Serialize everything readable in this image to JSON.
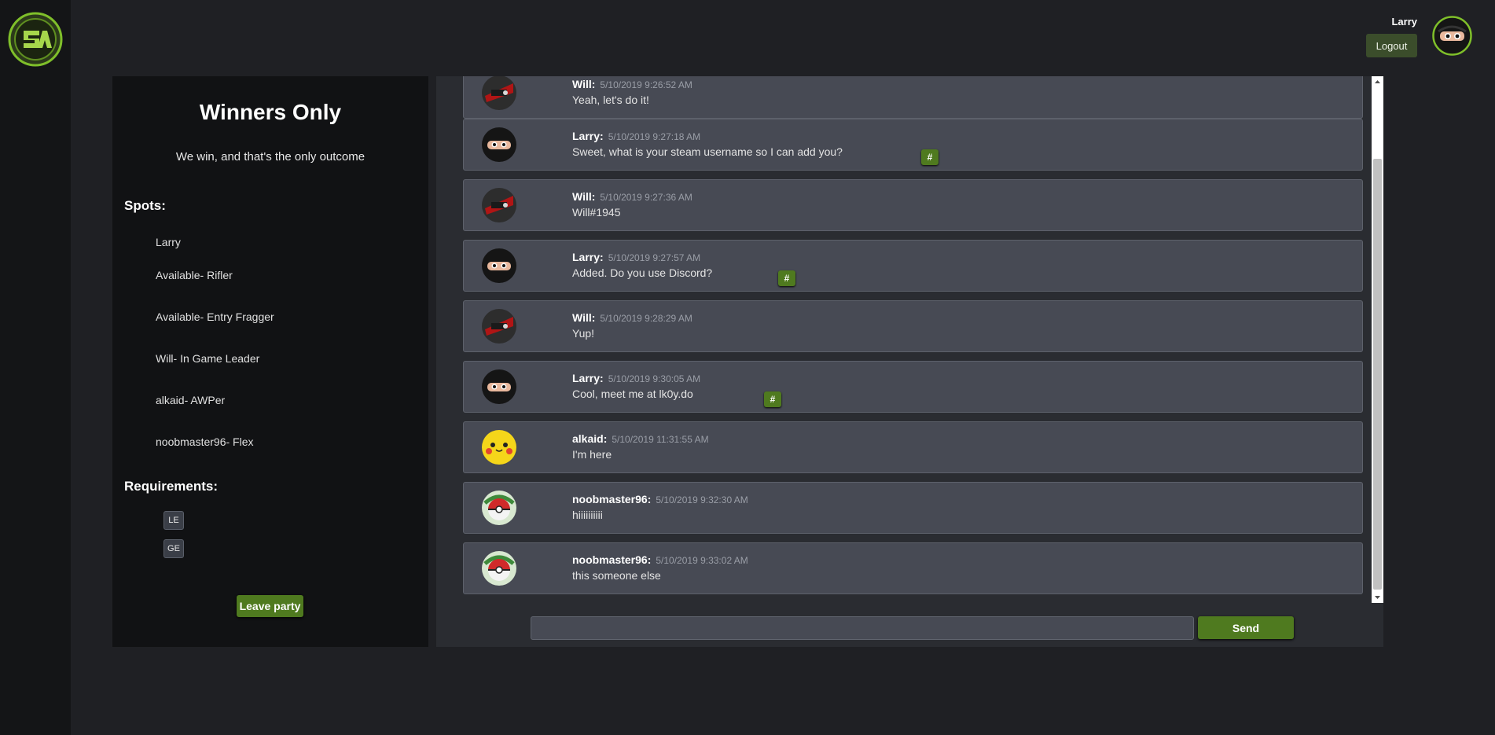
{
  "header": {
    "user_name": "Larry",
    "logout_label": "Logout",
    "avatar_icon": "ninja-avatar-icon"
  },
  "logo": {
    "icon": "sa-logo-icon",
    "accent_color": "#7fbf2a"
  },
  "party": {
    "title": "Winners Only",
    "description": "We win, and that's the only outcome",
    "spots_heading": "Spots:",
    "spots": [
      "Larry",
      "Available- Rifler",
      "Available- Entry Fragger",
      "Will- In Game Leader",
      "alkaid- AWPer",
      "noobmaster96- Flex"
    ],
    "requirements_heading": "Requirements:",
    "requirements": [
      "LE",
      "GE"
    ],
    "leave_label": "Leave party"
  },
  "chat": {
    "messages": [
      {
        "sender": "Will:",
        "time": "5/10/2019 9:26:52 AM",
        "text": "Yeah, let's do it!",
        "avatar": "red-ninja-avatar-icon",
        "action": ""
      },
      {
        "sender": "Larry:",
        "time": "5/10/2019 9:27:18 AM",
        "text": "Sweet, what is your steam username so I can add you?",
        "avatar": "ninja-avatar-icon",
        "action": "#"
      },
      {
        "sender": "Will:",
        "time": "5/10/2019 9:27:36 AM",
        "text": "Will#1945",
        "avatar": "red-ninja-avatar-icon",
        "action": ""
      },
      {
        "sender": "Larry:",
        "time": "5/10/2019 9:27:57 AM",
        "text": "Added. Do you use Discord?",
        "avatar": "ninja-avatar-icon",
        "action": "#"
      },
      {
        "sender": "Will:",
        "time": "5/10/2019 9:28:29 AM",
        "text": "Yup!",
        "avatar": "red-ninja-avatar-icon",
        "action": ""
      },
      {
        "sender": "Larry:",
        "time": "5/10/2019 9:30:05 AM",
        "text": "Cool, meet me at lk0y.do",
        "avatar": "ninja-avatar-icon",
        "action": "#"
      },
      {
        "sender": "alkaid:",
        "time": "5/10/2019 11:31:55 AM",
        "text": "I'm here",
        "avatar": "pikachu-avatar-icon",
        "action": ""
      },
      {
        "sender": "noobmaster96:",
        "time": "5/10/2019 9:32:30 AM",
        "text": "hiiiiiiiiii",
        "avatar": "pokeball-avatar-icon",
        "action": ""
      },
      {
        "sender": "noobmaster96:",
        "time": "5/10/2019 9:33:02 AM",
        "text": "this someone else",
        "avatar": "pokeball-avatar-icon",
        "action": ""
      }
    ],
    "input_value": "",
    "send_label": "Send"
  },
  "colors": {
    "background": "#1f2024",
    "panel": "#111214",
    "message": "#474a54",
    "accent_green": "#4f7a1f"
  }
}
